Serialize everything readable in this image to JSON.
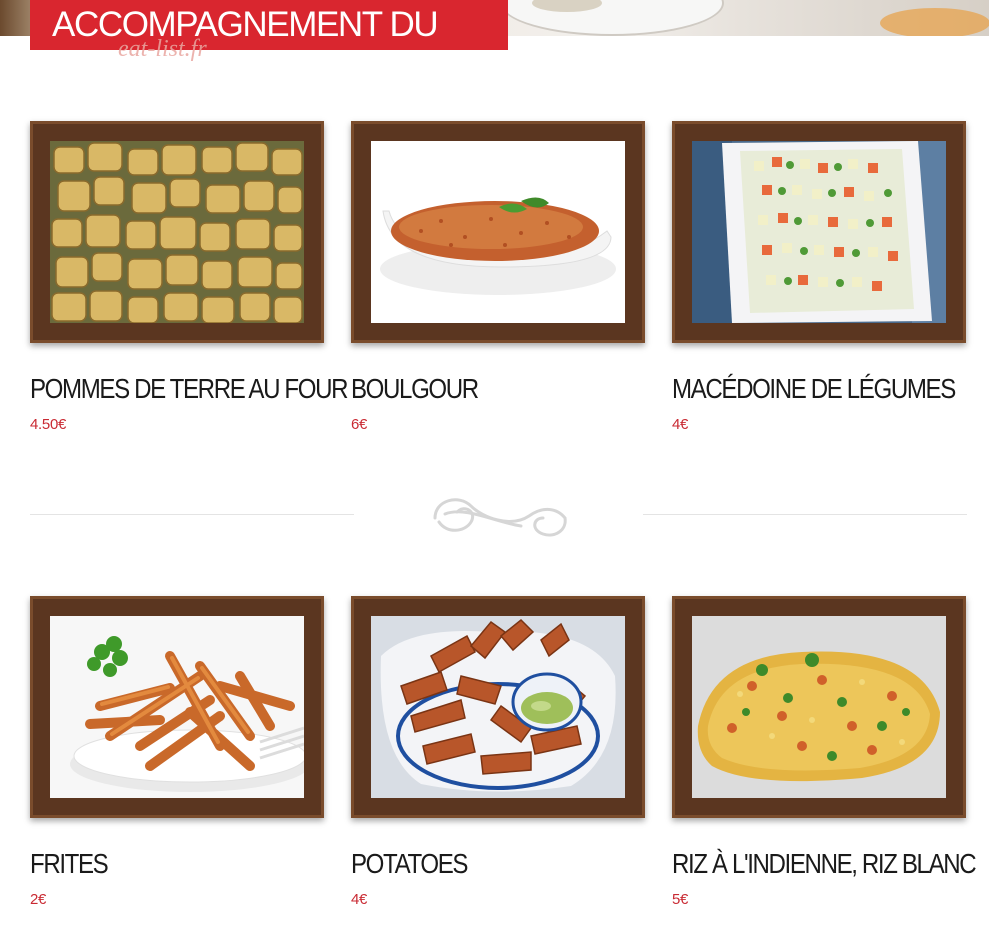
{
  "header": {
    "section_title": "ACCOMPAGNEMENT DU JOUR",
    "watermark": "eat-list.fr"
  },
  "dishes": [
    {
      "name": "POMMES DE TERRE AU FOUR",
      "price": "4.50€"
    },
    {
      "name": "BOULGOUR",
      "price": "6€"
    },
    {
      "name": "MACÉDOINE DE LÉGUMES",
      "price": "4€"
    },
    {
      "name": "FRITES",
      "price": "2€"
    },
    {
      "name": "POTATOES",
      "price": "4€"
    },
    {
      "name": "RIZ À L'INDIENNE, RIZ BLANC",
      "price": "5€"
    }
  ],
  "colors": {
    "accent_red": "#d9262f",
    "price_red": "#c92a33",
    "frame_wood": "#5b3620"
  }
}
